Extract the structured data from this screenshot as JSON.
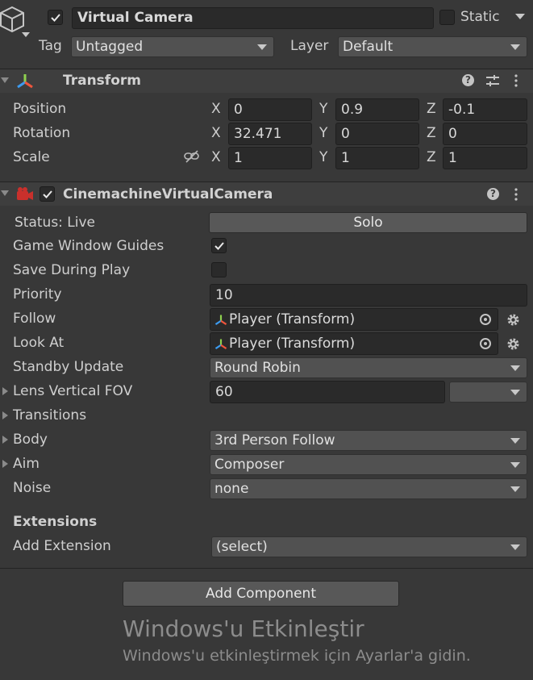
{
  "object": {
    "name": "Virtual Camera",
    "static_label": "Static",
    "tag_label": "Tag",
    "tag_value": "Untagged",
    "layer_label": "Layer",
    "layer_value": "Default"
  },
  "transform": {
    "title": "Transform",
    "rows": [
      {
        "label": "Position",
        "x": "0",
        "y": "0.9",
        "z": "-0.1"
      },
      {
        "label": "Rotation",
        "x": "32.471",
        "y": "0",
        "z": "0"
      },
      {
        "label": "Scale",
        "x": "1",
        "y": "1",
        "z": "1"
      }
    ],
    "axes": {
      "x": "X",
      "y": "Y",
      "z": "Z"
    }
  },
  "vcam": {
    "title": "CinemachineVirtualCamera",
    "status_label": "Status: Live",
    "solo_label": "Solo",
    "game_window_guides_label": "Game Window Guides",
    "game_window_guides_checked": true,
    "save_during_play_label": "Save During Play",
    "save_during_play_checked": false,
    "priority_label": "Priority",
    "priority_value": "10",
    "follow_label": "Follow",
    "follow_value": "Player (Transform)",
    "look_at_label": "Look At",
    "look_at_value": "Player (Transform)",
    "standby_label": "Standby Update",
    "standby_value": "Round Robin",
    "lens_label": "Lens Vertical FOV",
    "lens_value": "60",
    "transitions_label": "Transitions",
    "body_label": "Body",
    "body_value": "3rd Person Follow",
    "aim_label": "Aim",
    "aim_value": "Composer",
    "noise_label": "Noise",
    "noise_value": "none",
    "extensions_label": "Extensions",
    "add_extension_label": "Add Extension",
    "add_extension_value": "(select)"
  },
  "add_component_label": "Add Component",
  "watermark": {
    "title": "Windows'u Etkinleştir",
    "subtitle": "Windows'u etkinleştirmek için Ayarlar'a gidin."
  }
}
